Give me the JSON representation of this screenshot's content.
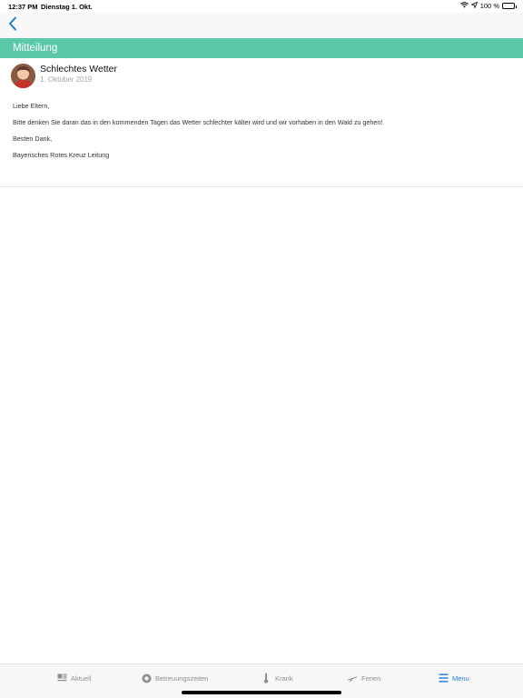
{
  "status_bar": {
    "time": "12:37 PM",
    "date": "Dienstag 1. Okt.",
    "battery_text": "100 %"
  },
  "nav": {
    "back_icon": "chevron-left-icon",
    "accent_color": "#1e7bd9"
  },
  "section": {
    "title": "Mitteilung",
    "color": "#5bc8a8"
  },
  "message": {
    "title": "Schlechtes Wetter",
    "date": "1. Oktober 2019",
    "body": [
      "Liebe Eltern,",
      "Bitte denken Sie daran das in den kommenden Tagen das Wetter schlechter kälter wird und wir vorhaben in den Wald zu gehen!",
      "Besten Dank,",
      "Bayerisches Rotes Kreuz Leitung"
    ]
  },
  "tabs": [
    {
      "label": "Aktuell",
      "icon": "news-icon",
      "active": false
    },
    {
      "label": "Betreuungszeiten",
      "icon": "clock-icon",
      "active": false
    },
    {
      "label": "Krank",
      "icon": "thermometer-icon",
      "active": false
    },
    {
      "label": "Ferien",
      "icon": "airplane-icon",
      "active": false
    },
    {
      "label": "Menu",
      "icon": "menu-icon",
      "active": true
    }
  ]
}
